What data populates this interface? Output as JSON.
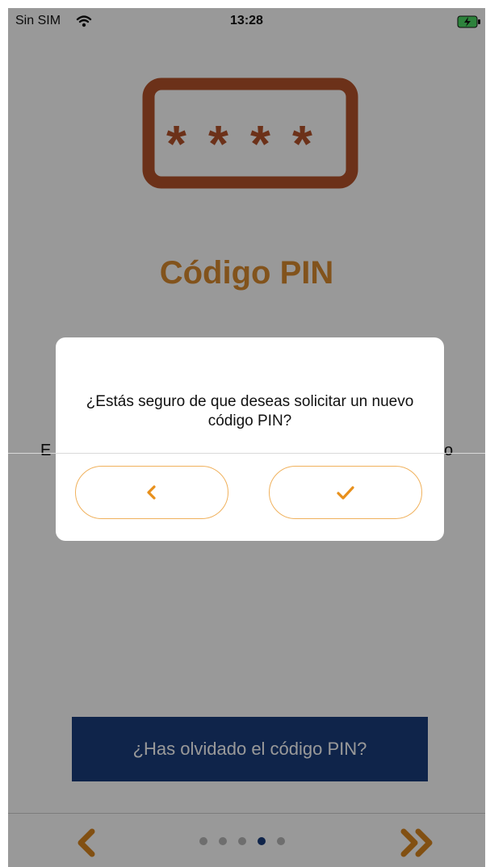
{
  "status_bar": {
    "carrier": "Sin SIM",
    "time": "13:28"
  },
  "content": {
    "title": "Código PIN",
    "description_left": "E",
    "description_right": "o",
    "forgot_button": "¿Has olvidado el código PIN?"
  },
  "pager": {
    "pages": 5,
    "active_index": 3
  },
  "dialog": {
    "message": "¿Estás seguro de que deseas solicitar un nuevo código PIN?",
    "cancel_icon": "chevron-left-icon",
    "confirm_icon": "check-icon"
  },
  "colors": {
    "accent": "#d98a2f",
    "nav_orange": "#d9861f",
    "primary_blue": "#1a3d7c",
    "pill_border": "#f0b15c",
    "pin_icon": "#b5532a"
  }
}
